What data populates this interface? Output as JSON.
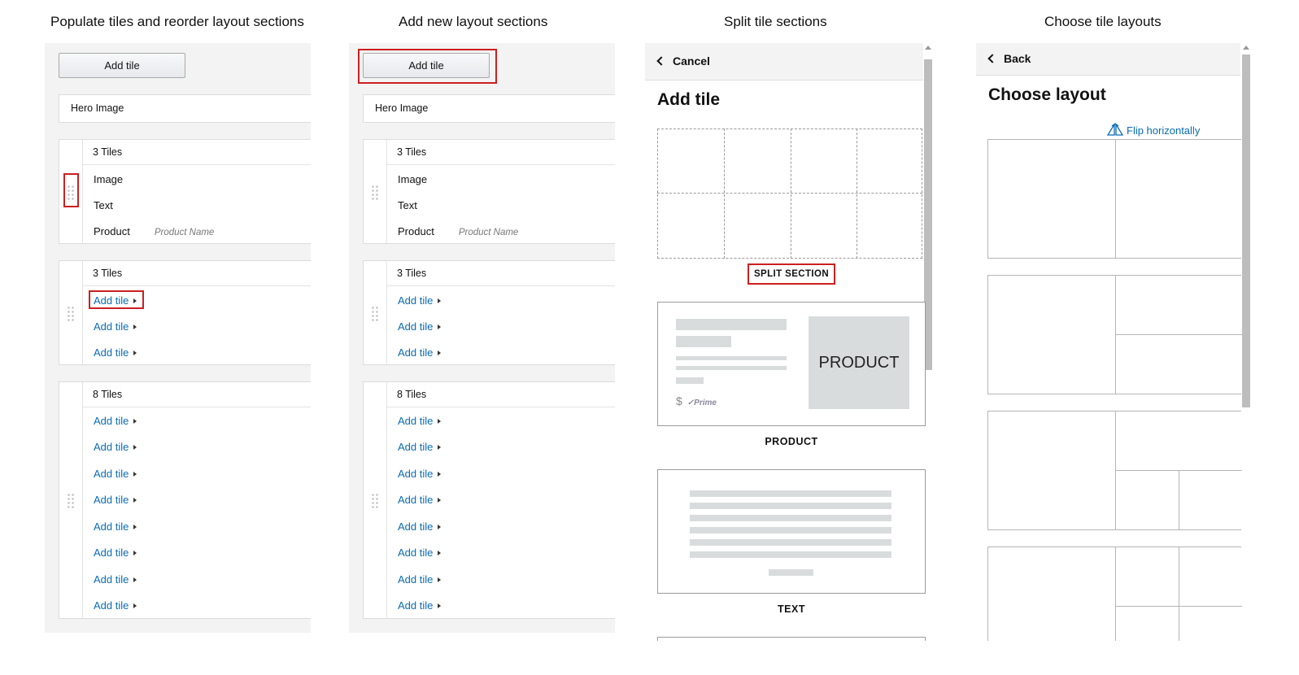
{
  "headings": [
    "Populate tiles and reorder layout sections",
    "Add new layout sections",
    "Split tile sections",
    "Choose tile layouts"
  ],
  "builder": {
    "add_tile_button": "Add tile",
    "hero_label": "Hero Image",
    "section1": {
      "title": "3 Tiles",
      "rows": [
        "Image",
        "Text",
        "Product"
      ],
      "product_placeholder": "Product Name"
    },
    "section2": {
      "title": "3 Tiles"
    },
    "section3": {
      "title": "8 Tiles"
    },
    "add_tile_link": "Add tile"
  },
  "add_tile_panel": {
    "cancel_label": "Cancel",
    "title": "Add tile",
    "split_label": "SPLIT SECTION",
    "product_card_text": "PRODUCT",
    "product_card_price": "$",
    "product_card_prime": "✓Prime",
    "product_label": "PRODUCT",
    "text_label": "TEXT"
  },
  "layout_panel": {
    "back_label": "Back",
    "title": "Choose layout",
    "flip_label": "Flip horizontally"
  },
  "colors": {
    "link": "#0a6cb4",
    "highlight": "#cc1f1f",
    "panel_bg": "#f3f3f3"
  }
}
